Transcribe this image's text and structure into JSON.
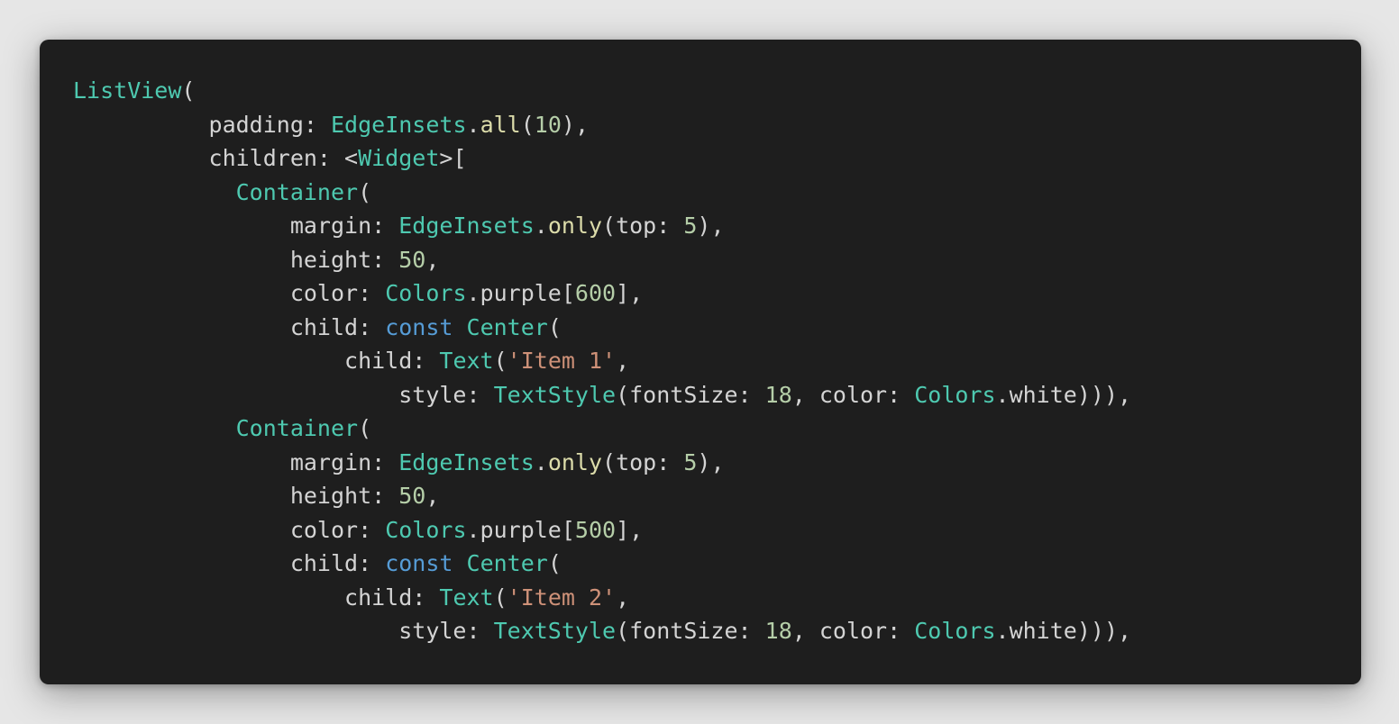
{
  "code_block": {
    "language": "dart",
    "colors": {
      "background": "#1e1e1e",
      "plain": "#d4d4d4",
      "type": "#4ec9b0",
      "function": "#dcdcaa",
      "number": "#b5cea8",
      "string": "#ce9178",
      "keyword": "#569cd6"
    },
    "lines": [
      [
        [
          "type",
          "ListView"
        ],
        [
          "plain",
          "("
        ]
      ],
      [
        [
          "plain",
          "          padding: "
        ],
        [
          "type",
          "EdgeInsets"
        ],
        [
          "plain",
          "."
        ],
        [
          "fn",
          "all"
        ],
        [
          "plain",
          "("
        ],
        [
          "num",
          "10"
        ],
        [
          "plain",
          "),"
        ]
      ],
      [
        [
          "plain",
          "          children: <"
        ],
        [
          "type",
          "Widget"
        ],
        [
          "plain",
          ">["
        ]
      ],
      [
        [
          "plain",
          "            "
        ],
        [
          "type",
          "Container"
        ],
        [
          "plain",
          "("
        ]
      ],
      [
        [
          "plain",
          "                margin: "
        ],
        [
          "type",
          "EdgeInsets"
        ],
        [
          "plain",
          "."
        ],
        [
          "fn",
          "only"
        ],
        [
          "plain",
          "(top: "
        ],
        [
          "num",
          "5"
        ],
        [
          "plain",
          "),"
        ]
      ],
      [
        [
          "plain",
          "                height: "
        ],
        [
          "num",
          "50"
        ],
        [
          "plain",
          ","
        ]
      ],
      [
        [
          "plain",
          "                color: "
        ],
        [
          "type",
          "Colors"
        ],
        [
          "plain",
          ".purple["
        ],
        [
          "num",
          "600"
        ],
        [
          "plain",
          "],"
        ]
      ],
      [
        [
          "plain",
          "                child: "
        ],
        [
          "kw",
          "const"
        ],
        [
          "plain",
          " "
        ],
        [
          "type",
          "Center"
        ],
        [
          "plain",
          "("
        ]
      ],
      [
        [
          "plain",
          "                    child: "
        ],
        [
          "type",
          "Text"
        ],
        [
          "plain",
          "("
        ],
        [
          "str",
          "'Item 1'"
        ],
        [
          "plain",
          ","
        ]
      ],
      [
        [
          "plain",
          "                        style: "
        ],
        [
          "type",
          "TextStyle"
        ],
        [
          "plain",
          "(fontSize: "
        ],
        [
          "num",
          "18"
        ],
        [
          "plain",
          ", color: "
        ],
        [
          "type",
          "Colors"
        ],
        [
          "plain",
          ".white))),"
        ]
      ],
      [
        [
          "plain",
          "            "
        ],
        [
          "type",
          "Container"
        ],
        [
          "plain",
          "("
        ]
      ],
      [
        [
          "plain",
          "                margin: "
        ],
        [
          "type",
          "EdgeInsets"
        ],
        [
          "plain",
          "."
        ],
        [
          "fn",
          "only"
        ],
        [
          "plain",
          "(top: "
        ],
        [
          "num",
          "5"
        ],
        [
          "plain",
          "),"
        ]
      ],
      [
        [
          "plain",
          "                height: "
        ],
        [
          "num",
          "50"
        ],
        [
          "plain",
          ","
        ]
      ],
      [
        [
          "plain",
          "                color: "
        ],
        [
          "type",
          "Colors"
        ],
        [
          "plain",
          ".purple["
        ],
        [
          "num",
          "500"
        ],
        [
          "plain",
          "],"
        ]
      ],
      [
        [
          "plain",
          "                child: "
        ],
        [
          "kw",
          "const"
        ],
        [
          "plain",
          " "
        ],
        [
          "type",
          "Center"
        ],
        [
          "plain",
          "("
        ]
      ],
      [
        [
          "plain",
          "                    child: "
        ],
        [
          "type",
          "Text"
        ],
        [
          "plain",
          "("
        ],
        [
          "str",
          "'Item 2'"
        ],
        [
          "plain",
          ","
        ]
      ],
      [
        [
          "plain",
          "                        style: "
        ],
        [
          "type",
          "TextStyle"
        ],
        [
          "plain",
          "(fontSize: "
        ],
        [
          "num",
          "18"
        ],
        [
          "plain",
          ", color: "
        ],
        [
          "type",
          "Colors"
        ],
        [
          "plain",
          ".white))),"
        ]
      ]
    ]
  }
}
